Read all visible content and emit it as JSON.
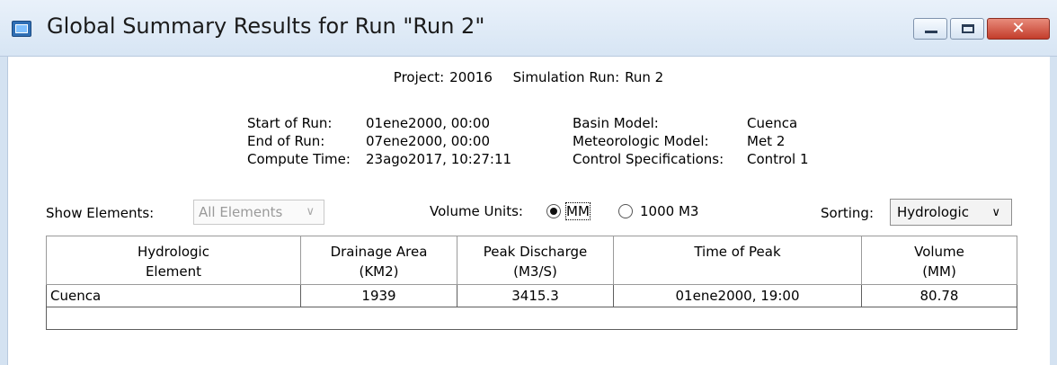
{
  "window": {
    "title": "Global Summary Results for Run \"Run 2\"",
    "close_glyph": "✕"
  },
  "header": {
    "project_label": "Project:",
    "project_value": "20016",
    "run_label": "Simulation Run:",
    "run_value": "Run 2"
  },
  "run_info": {
    "start_label": "Start of Run:",
    "start_value": "01ene2000, 00:00",
    "end_label": "End of Run:",
    "end_value": "07ene2000, 00:00",
    "compute_label": "Compute Time:",
    "compute_value": "23ago2017, 10:27:11",
    "basin_label": "Basin Model:",
    "basin_value": "Cuenca",
    "met_label": "Meteorologic Model:",
    "met_value": "Met 2",
    "control_label": "Control Specifications:",
    "control_value": "Control 1"
  },
  "controls": {
    "show_elements_label": "Show Elements:",
    "show_elements_value": "All Elements",
    "volume_units_label": "Volume Units:",
    "volume_option_1": "MM",
    "volume_option_2": "1000 M3",
    "volume_selected": "MM",
    "sorting_label": "Sorting:",
    "sorting_value": "Hydrologic"
  },
  "table": {
    "headers": [
      [
        "Hydrologic",
        "Element"
      ],
      [
        "Drainage Area",
        "(KM2)"
      ],
      [
        "Peak Discharge",
        "(M3/S)"
      ],
      [
        "Time of Peak",
        ""
      ],
      [
        "Volume",
        "(MM)"
      ]
    ],
    "rows": [
      [
        "Cuenca",
        "1939",
        "3415.3",
        "01ene2000, 19:00",
        "80.78"
      ]
    ]
  }
}
